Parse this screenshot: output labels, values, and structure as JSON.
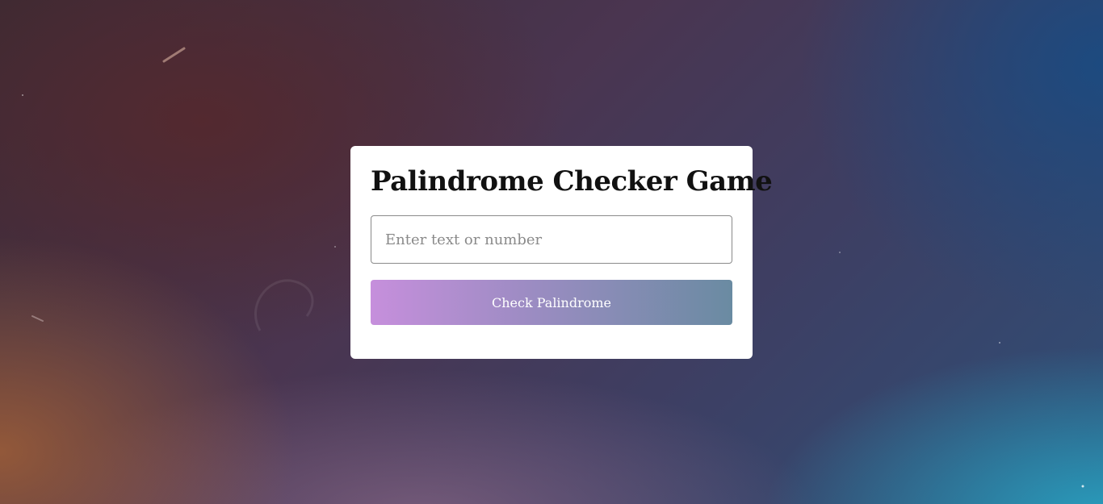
{
  "game": {
    "title": "Palindrome Checker Game",
    "input": {
      "value": "",
      "placeholder": "Enter text or number"
    },
    "check_button_label": "Check Palindrome"
  },
  "colors": {
    "card_background": "#ffffff",
    "button_gradient_start": "#c68fdc",
    "button_gradient_end": "#6a8ba2",
    "title_text": "#111111",
    "placeholder_text": "#8a8a8a"
  }
}
